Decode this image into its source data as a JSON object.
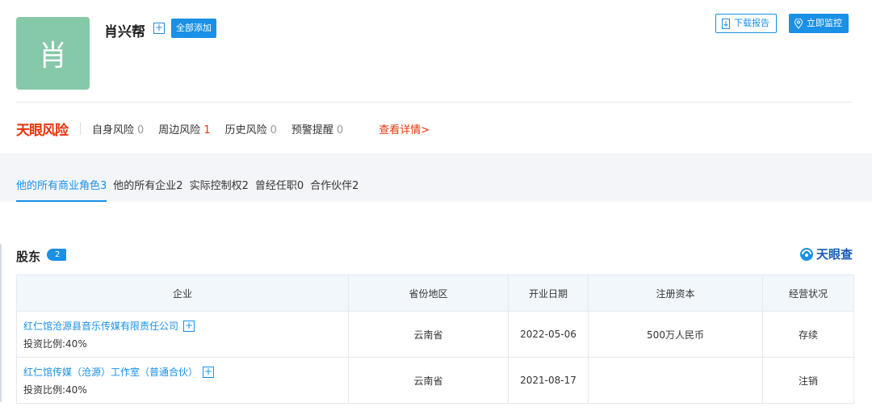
{
  "person": {
    "avatar_char": "肖",
    "name": "肖兴帮",
    "add_all_label": "全部添加"
  },
  "actions": {
    "download_label": "下载报告",
    "monitor_label": "立即监控"
  },
  "risk": {
    "logo": "天眼风险",
    "items": [
      {
        "label": "自身风险",
        "count": "0"
      },
      {
        "label": "周边风险",
        "count": "1"
      },
      {
        "label": "历史风险",
        "count": "0"
      },
      {
        "label": "预警提醒",
        "count": "0"
      }
    ],
    "detail_label": "查看详情>"
  },
  "tabs": [
    {
      "label": "他的所有商业角色3"
    },
    {
      "label": "他的所有企业2"
    },
    {
      "label": "实际控制权2"
    },
    {
      "label": "曾经任职0"
    },
    {
      "label": "合作伙伴2"
    }
  ],
  "section": {
    "title": "股东",
    "count": "2",
    "logo_text": "天眼查"
  },
  "table": {
    "headers": [
      "企业",
      "省份地区",
      "开业日期",
      "注册资本",
      "经营状况"
    ],
    "rows": [
      {
        "company": "红仁馆沧源县音乐传媒有限责任公司",
        "ratio": "投资比例:40%",
        "province": "云南省",
        "date": "2022-05-06",
        "capital": "500万人民币",
        "status": "存续"
      },
      {
        "company": "红仁馆传媒（沧源）工作室（普通合伙）",
        "ratio": "投资比例:40%",
        "province": "云南省",
        "date": "2021-08-17",
        "capital": "",
        "status": "注销"
      }
    ]
  },
  "colors": {
    "accent": "#1a90e6",
    "risk_red": "#e8340b",
    "avatar_bg": "#86c9a9"
  }
}
